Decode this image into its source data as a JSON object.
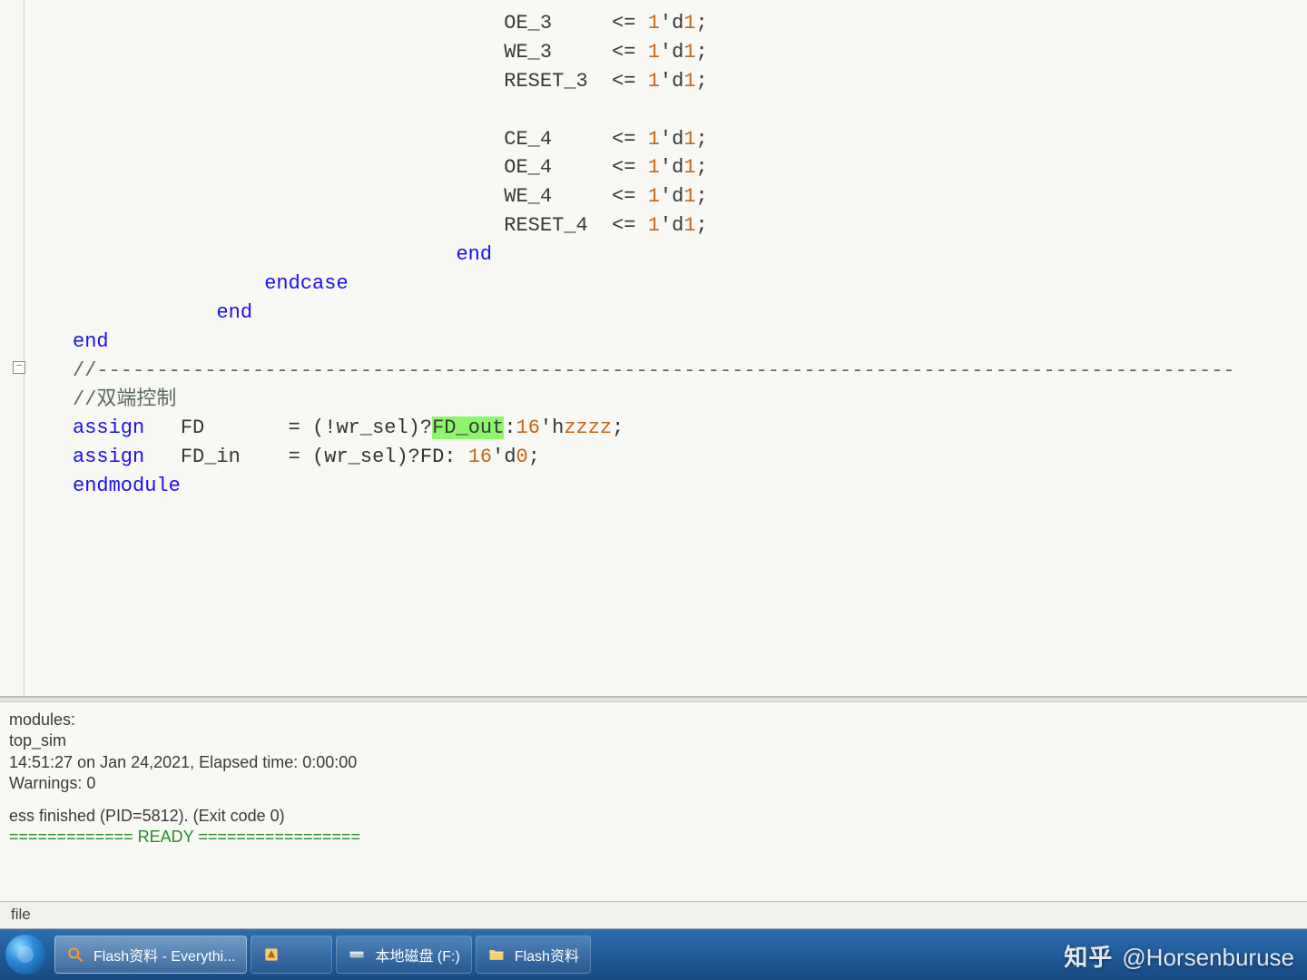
{
  "code": {
    "lines": [
      {
        "indent": 36,
        "tokens": [
          [
            "id",
            "OE_3"
          ],
          [
            "pad",
            "     "
          ],
          [
            "op",
            "<= "
          ],
          [
            "num",
            "1"
          ],
          [
            "op",
            "'"
          ],
          [
            "id",
            "d"
          ],
          [
            "num",
            "1"
          ],
          [
            "op",
            ";"
          ]
        ]
      },
      {
        "indent": 36,
        "tokens": [
          [
            "id",
            "WE_3"
          ],
          [
            "pad",
            "     "
          ],
          [
            "op",
            "<= "
          ],
          [
            "num",
            "1"
          ],
          [
            "op",
            "'"
          ],
          [
            "id",
            "d"
          ],
          [
            "num",
            "1"
          ],
          [
            "op",
            ";"
          ]
        ]
      },
      {
        "indent": 36,
        "tokens": [
          [
            "id",
            "RESET_3"
          ],
          [
            "pad",
            "  "
          ],
          [
            "op",
            "<= "
          ],
          [
            "num",
            "1"
          ],
          [
            "op",
            "'"
          ],
          [
            "id",
            "d"
          ],
          [
            "num",
            "1"
          ],
          [
            "op",
            ";"
          ]
        ]
      },
      {
        "indent": 36,
        "tokens": []
      },
      {
        "indent": 36,
        "tokens": [
          [
            "id",
            "CE_4"
          ],
          [
            "pad",
            "     "
          ],
          [
            "op",
            "<= "
          ],
          [
            "num",
            "1"
          ],
          [
            "op",
            "'"
          ],
          [
            "id",
            "d"
          ],
          [
            "num",
            "1"
          ],
          [
            "op",
            ";"
          ]
        ]
      },
      {
        "indent": 36,
        "tokens": [
          [
            "id",
            "OE_4"
          ],
          [
            "pad",
            "     "
          ],
          [
            "op",
            "<= "
          ],
          [
            "num",
            "1"
          ],
          [
            "op",
            "'"
          ],
          [
            "id",
            "d"
          ],
          [
            "num",
            "1"
          ],
          [
            "op",
            ";"
          ]
        ]
      },
      {
        "indent": 36,
        "tokens": [
          [
            "id",
            "WE_4"
          ],
          [
            "pad",
            "     "
          ],
          [
            "op",
            "<= "
          ],
          [
            "num",
            "1"
          ],
          [
            "op",
            "'"
          ],
          [
            "id",
            "d"
          ],
          [
            "num",
            "1"
          ],
          [
            "op",
            ";"
          ]
        ]
      },
      {
        "indent": 36,
        "tokens": [
          [
            "id",
            "RESET_4"
          ],
          [
            "pad",
            "  "
          ],
          [
            "op",
            "<= "
          ],
          [
            "num",
            "1"
          ],
          [
            "op",
            "'"
          ],
          [
            "id",
            "d"
          ],
          [
            "num",
            "1"
          ],
          [
            "op",
            ";"
          ]
        ]
      },
      {
        "indent": 32,
        "tokens": [
          [
            "kw",
            "end"
          ]
        ]
      },
      {
        "indent": 16,
        "tokens": [
          [
            "kw",
            "endcase"
          ]
        ]
      },
      {
        "indent": 12,
        "tokens": [
          [
            "kw",
            "end"
          ]
        ]
      },
      {
        "indent": 0,
        "tokens": [
          [
            "kw",
            "end"
          ]
        ]
      },
      {
        "indent": 0,
        "tokens": [
          [
            "cmt",
            "//-----------------------------------------------------------------------------------------------"
          ]
        ]
      },
      {
        "indent": 0,
        "tokens": [
          [
            "cmt",
            "//双端控制"
          ]
        ]
      },
      {
        "indent": 0,
        "tokens": [
          [
            "kw",
            "assign"
          ],
          [
            "pad",
            "   "
          ],
          [
            "id",
            "FD"
          ],
          [
            "pad",
            "       "
          ],
          [
            "op",
            "= (!wr_sel)?"
          ],
          [
            "hl",
            "FD_out"
          ],
          [
            "op",
            ":"
          ],
          [
            "num",
            "16"
          ],
          [
            "op",
            "'"
          ],
          [
            "id",
            "h"
          ],
          [
            "num",
            "zzzz"
          ],
          [
            "op",
            ";"
          ]
        ]
      },
      {
        "indent": 0,
        "tokens": [
          [
            "kw",
            "assign"
          ],
          [
            "pad",
            "   "
          ],
          [
            "id",
            "FD_in"
          ],
          [
            "pad",
            "    "
          ],
          [
            "op",
            "= (wr_sel)?FD: "
          ],
          [
            "num",
            "16"
          ],
          [
            "op",
            "'"
          ],
          [
            "id",
            "d"
          ],
          [
            "num",
            "0"
          ],
          [
            "op",
            ";"
          ]
        ]
      },
      {
        "indent": 0,
        "tokens": [
          [
            "kw",
            "endmodule"
          ]
        ]
      }
    ]
  },
  "console": {
    "l1": "modules:",
    "l2": " top_sim",
    "l3": " 14:51:27 on Jan 24,2021, Elapsed time: 0:00:00",
    "l4": " Warnings: 0",
    "l5": "ess finished (PID=5812). (Exit code 0)",
    "l6": "============= READY ================="
  },
  "statusbar": {
    "text": "file"
  },
  "taskbar": {
    "item1": "Flash资料 - Everythi...",
    "item2": "",
    "item3": "本地磁盘 (F:)",
    "item4": "Flash资料"
  },
  "watermark": {
    "logo": "知乎",
    "user": "@Horsenburuse"
  }
}
